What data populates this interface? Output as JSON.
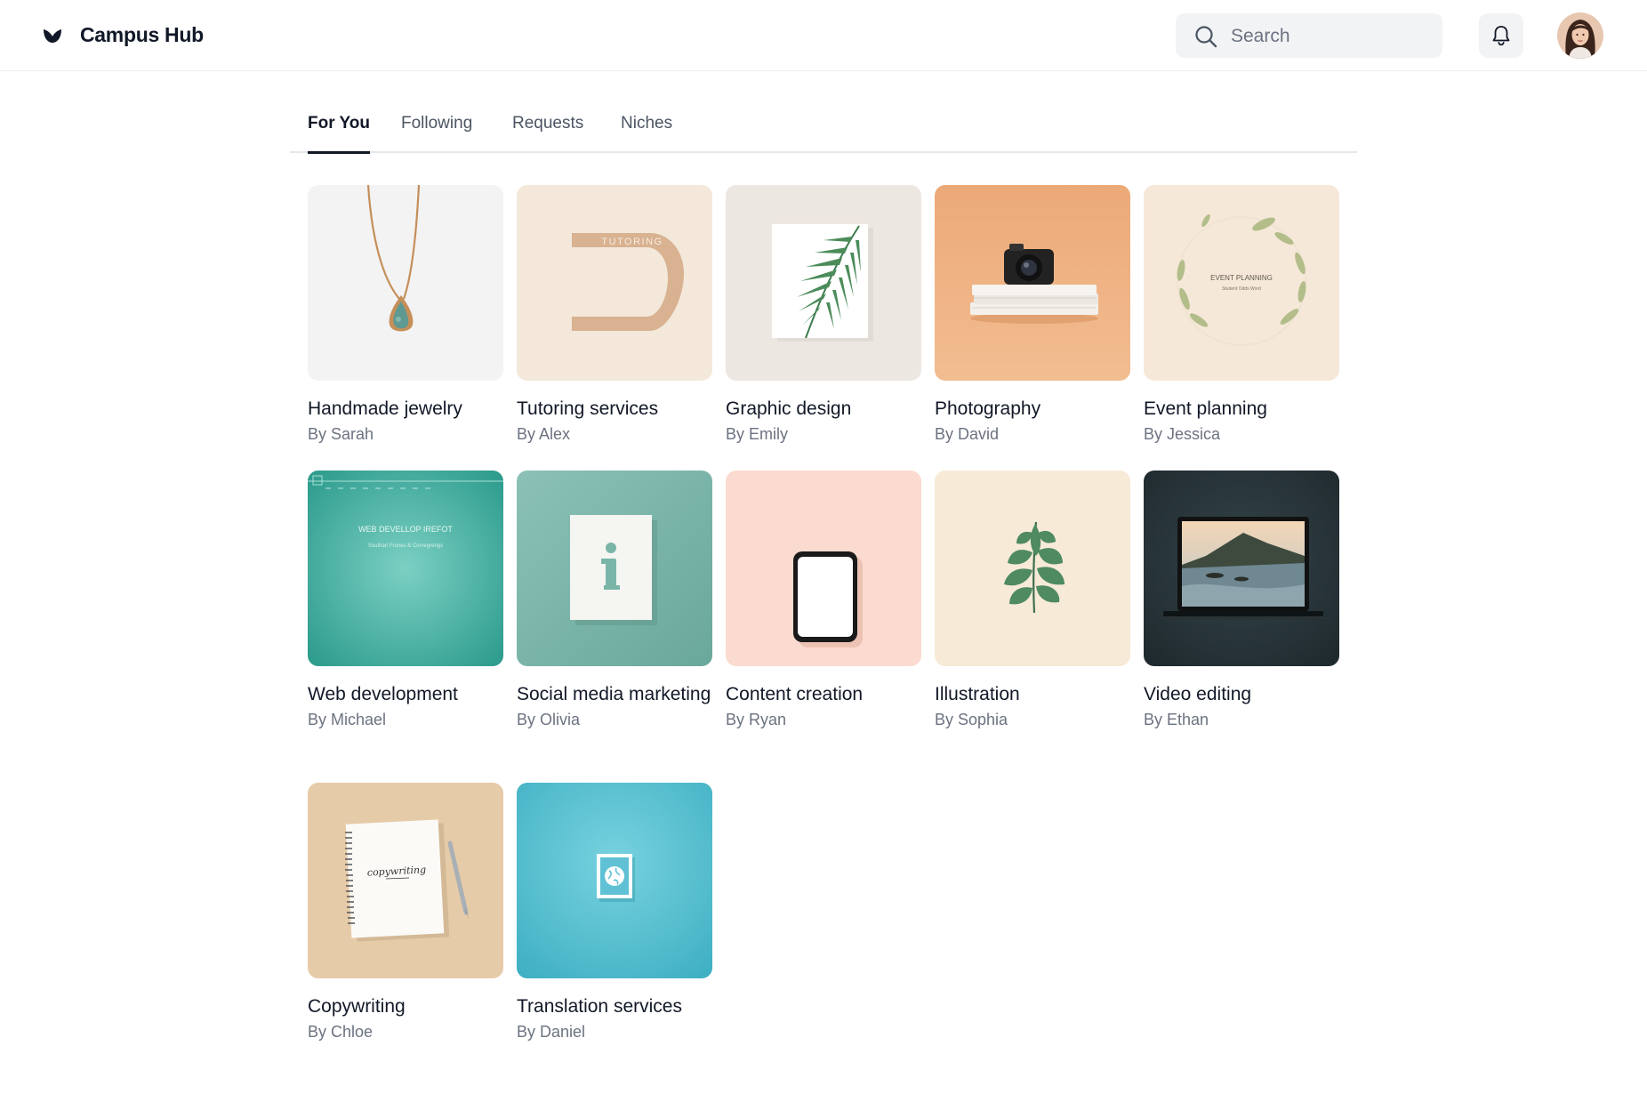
{
  "app": {
    "name": "Campus Hub"
  },
  "search": {
    "placeholder": "Search"
  },
  "icons": {
    "logo": "leaf-logo-icon",
    "search": "search-icon",
    "notifications": "bell-icon"
  },
  "tabs": [
    {
      "label": "For You",
      "active": true
    },
    {
      "label": "Following",
      "active": false
    },
    {
      "label": "Requests",
      "active": false
    },
    {
      "label": "Niches",
      "active": false
    }
  ],
  "cards": [
    {
      "title": "Handmade jewelry",
      "author": "By Sarah",
      "image": "necklace",
      "image_bg": "#f3f3f3"
    },
    {
      "title": "Tutoring services",
      "author": "By Alex",
      "image": "tutoring-sign",
      "image_text": "TUTORING",
      "image_bg": "#f3e8da"
    },
    {
      "title": "Graphic design",
      "author": "By Emily",
      "image": "palm-leaf-card",
      "image_bg": "#ede7e2"
    },
    {
      "title": "Photography",
      "author": "By David",
      "image": "camera-on-books",
      "image_bg": "#efb287"
    },
    {
      "title": "Event planning",
      "author": "By Jessica",
      "image": "leaf-wreath",
      "image_text": "EVENT PLANNING",
      "image_subtext": "Student Odds Word",
      "image_bg": "#f6e8d8"
    },
    {
      "title": "Web development",
      "author": "By Michael",
      "image": "web-page-mockup",
      "image_text": "WEB DEVELLOP IREFOT",
      "image_subtext": "Southari Frunes & Comegrengs",
      "image_bg": "#4fb4a5"
    },
    {
      "title": "Social media marketing",
      "author": "By Olivia",
      "image": "info-card",
      "image_bg": "#7fb8ac"
    },
    {
      "title": "Content creation",
      "author": "By Ryan",
      "image": "tablet",
      "image_bg": "#fbdbcf"
    },
    {
      "title": "Illustration",
      "author": "By Sophia",
      "image": "leaf-sprig",
      "image_bg": "#f7ead7"
    },
    {
      "title": "Video editing",
      "author": "By Ethan",
      "image": "laptop-landscape",
      "image_bg": "#263338"
    },
    {
      "title": "Copywriting",
      "author": "By Chloe",
      "image": "notebook-pen",
      "image_text": "copywriting",
      "image_bg": "#e6cba8"
    },
    {
      "title": "Translation services",
      "author": "By Daniel",
      "image": "globe-card",
      "image_bg": "#5fc6d6"
    }
  ]
}
